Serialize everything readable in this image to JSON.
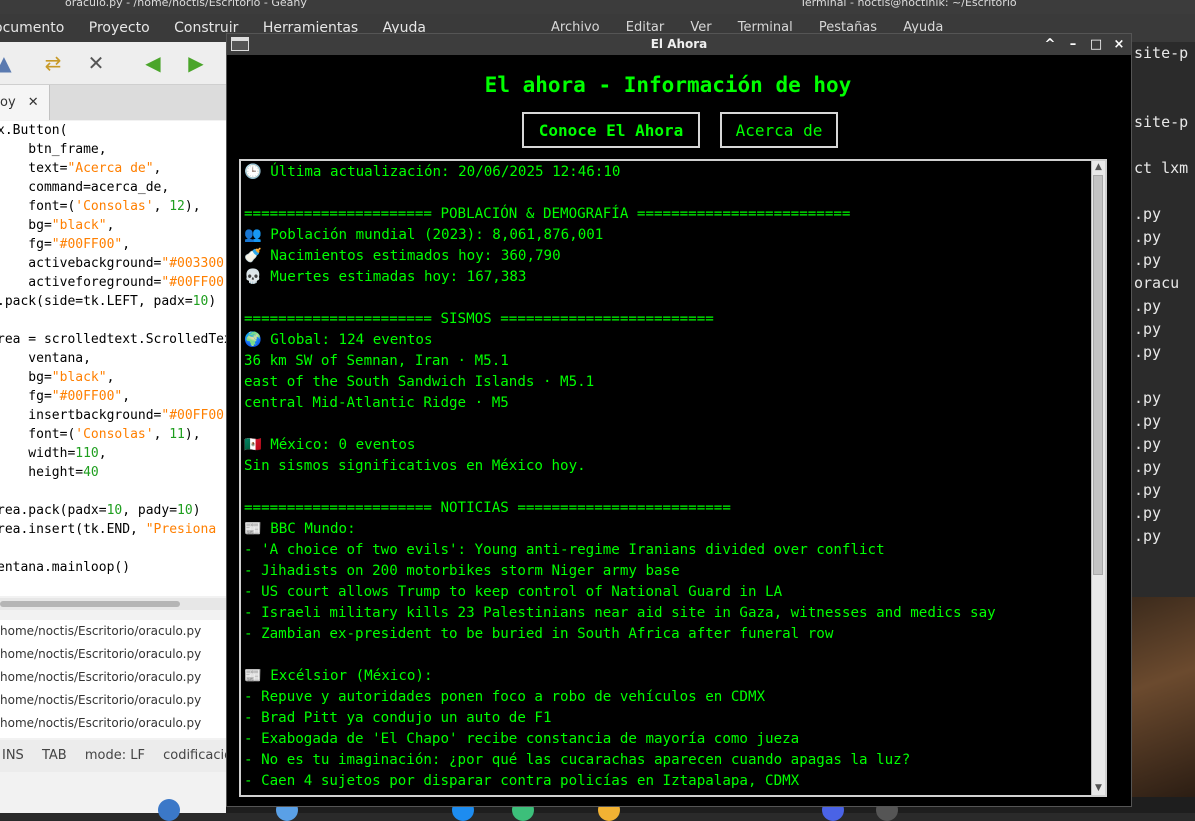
{
  "geany": {
    "title": "oraculo.py - /home/noctis/Escritorio - Geany",
    "menu": [
      "ocumento",
      "Proyecto",
      "Construir",
      "Herramientas",
      "Ayuda"
    ],
    "tab_label": "oy",
    "code_lines": [
      "x.Button(",
      "    btn_frame,",
      "    text=\"Acerca de\",",
      "    command=acerca_de,",
      "    font=('Consolas', 12),",
      "    bg=\"black\",",
      "    fg=\"#00FF00\",",
      "    activebackground=\"#003300\",",
      "    activeforeground=\"#00FF00\",",
      ".pack(side=tk.LEFT, padx=10)",
      "",
      "rea = scrolledtext.ScrolledText(",
      "    ventana,",
      "    bg=\"black\",",
      "    fg=\"#00FF00\",",
      "    insertbackground=\"#00FF00\",",
      "    font=('Consolas', 11),",
      "    width=110,",
      "    height=40",
      "",
      "rea.pack(padx=10, pady=10)",
      "rea.insert(tk.END, \"Presiona",
      "",
      "entana.mainloop()"
    ],
    "message_lines": [
      "/home/noctis/Escritorio/oraculo.py",
      "/home/noctis/Escritorio/oraculo.py",
      "/home/noctis/Escritorio/oraculo.py",
      "/home/noctis/Escritorio/oraculo.py",
      "/home/noctis/Escritorio/oraculo.py"
    ],
    "status": [
      "INS",
      "TAB",
      "mode: LF",
      "codificació"
    ]
  },
  "terminal": {
    "title": "Terminal - noctis@noctinik: ~/Escritorio",
    "menu": [
      "Archivo",
      "Editar",
      "Ver",
      "Terminal",
      "Pestañas",
      "Ayuda"
    ],
    "lines": [
      "site-p",
      "",
      "",
      "site-p",
      "",
      "ct lxm",
      "",
      ".py",
      ".py",
      ".py",
      " oracu",
      ".py",
      ".py",
      ".py",
      "",
      ".py",
      ".py",
      ".py",
      ".py",
      ".py",
      ".py",
      ".py"
    ]
  },
  "window": {
    "title": "El Ahora",
    "controls": {
      "up": "^",
      "minimize": "–",
      "maximize": "□",
      "close": "×"
    }
  },
  "app": {
    "heading": "El ahora - Información de hoy",
    "buttons": {
      "conoce": "Conoce El Ahora",
      "acerca": "Acerca de"
    },
    "text_lines": [
      "🕒 Última actualización: 20/06/2025 12:46:10",
      "",
      "====================== POBLACIÓN & DEMOGRAFÍA =========================",
      "👥 Población mundial (2023): 8,061,876,001",
      "🍼 Nacimientos estimados hoy: 360,790",
      "💀 Muertes estimadas hoy: 167,383",
      "",
      "====================== SISMOS =========================",
      "🌍 Global: 124 eventos",
      "36 km SW of Semnan, Iran · M5.1",
      "east of the South Sandwich Islands · M5.1",
      "central Mid-Atlantic Ridge · M5",
      "",
      "🇲🇽 México: 0 eventos",
      "Sin sismos significativos en México hoy.",
      "",
      "====================== NOTICIAS =========================",
      "📰 BBC Mundo:",
      "- 'A choice of two evils': Young anti-regime Iranians divided over conflict",
      "- Jihadists on 200 motorbikes storm Niger army base",
      "- US court allows Trump to keep control of National Guard in LA",
      "- Israeli military kills 23 Palestinians near aid site in Gaza, witnesses and medics say",
      "- Zambian ex-president to be buried in South Africa after funeral row",
      "",
      "📰 Excélsior (México):",
      "- Repuve y autoridades ponen foco a robo de vehículos en CDMX",
      "- Brad Pitt ya condujo un auto de F1",
      "- Exabogada de 'El Chapo' recibe constancia de mayoría como jueza",
      "- No es tu imaginación: ¿por qué las cucarachas aparecen cuando apagas la luz?",
      "- Caen 4 sujetos por disparar contra policías en Iztapalapa, CDMX"
    ]
  },
  "colors": {
    "app_bg": "#000000",
    "app_fg": "#00FF00",
    "titlebar": "#3d3d3d"
  }
}
